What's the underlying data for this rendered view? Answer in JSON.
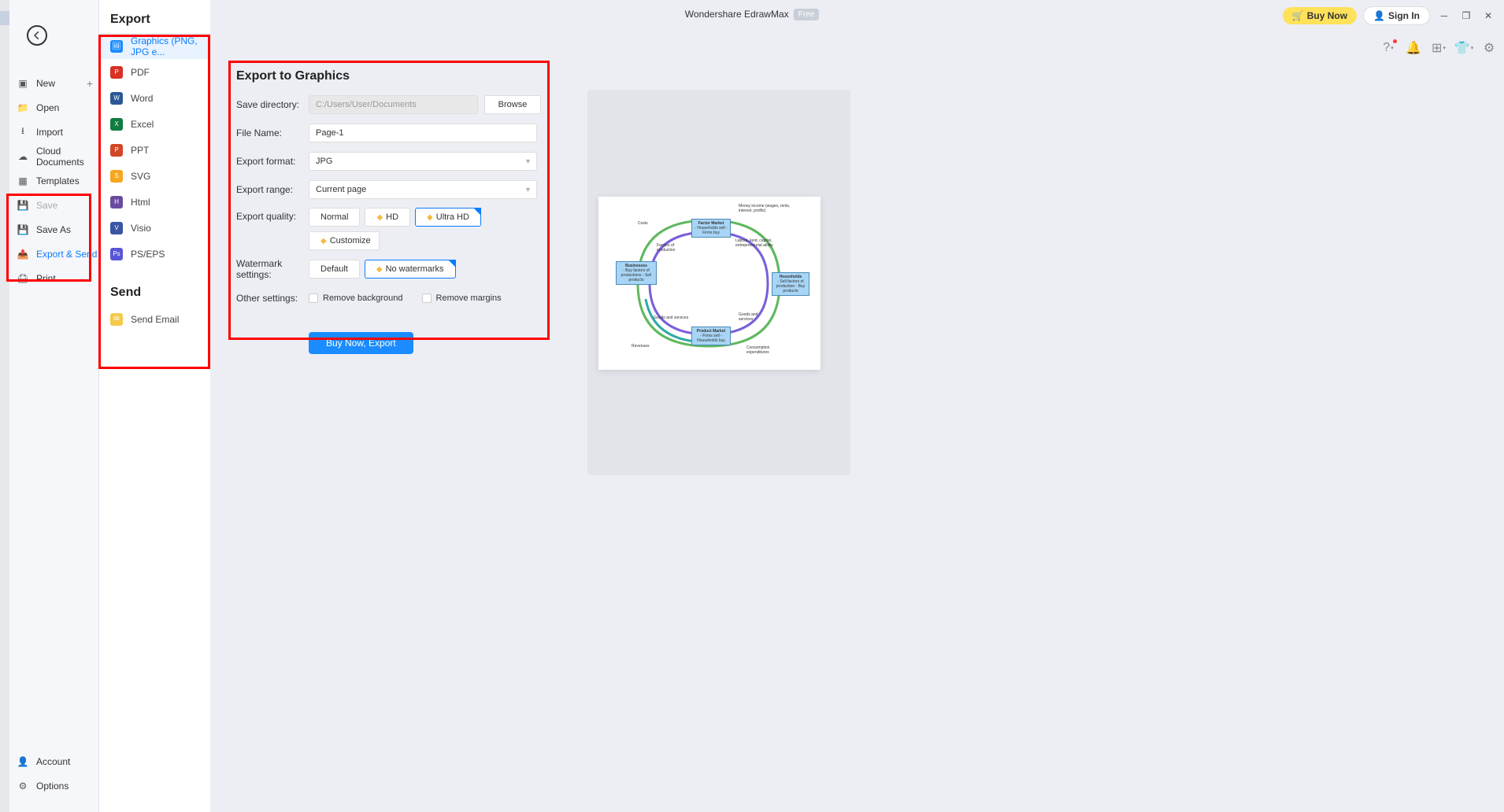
{
  "titlebar": {
    "app_title": "Wondershare EdrawMax",
    "free_badge": "Free",
    "buy_now": "Buy Now",
    "sign_in": "Sign In"
  },
  "left_sidebar": {
    "items": [
      {
        "label": "New",
        "icon": "plus-square",
        "has_plus": true
      },
      {
        "label": "Open",
        "icon": "folder"
      },
      {
        "label": "Import",
        "icon": "import"
      },
      {
        "label": "Cloud Documents",
        "icon": "cloud"
      },
      {
        "label": "Templates",
        "icon": "template"
      },
      {
        "label": "Save",
        "icon": "save",
        "disabled": true
      },
      {
        "label": "Save As",
        "icon": "save-as"
      },
      {
        "label": "Export & Send",
        "icon": "export",
        "selected": true
      },
      {
        "label": "Print",
        "icon": "print"
      }
    ],
    "bottom": [
      {
        "label": "Account",
        "icon": "account"
      },
      {
        "label": "Options",
        "icon": "gear"
      }
    ]
  },
  "export_panel": {
    "heading": "Export",
    "items": [
      {
        "label": "Graphics (PNG, JPG e...",
        "color": "#1a8cff",
        "active": true
      },
      {
        "label": "PDF",
        "color": "#d93025"
      },
      {
        "label": "Word",
        "color": "#2b5797"
      },
      {
        "label": "Excel",
        "color": "#107c41"
      },
      {
        "label": "PPT",
        "color": "#d24726"
      },
      {
        "label": "SVG",
        "color": "#f5a623"
      },
      {
        "label": "Html",
        "color": "#6a4ba0"
      },
      {
        "label": "Visio",
        "color": "#3955a3"
      },
      {
        "label": "PS/EPS",
        "color": "#5856d6"
      }
    ],
    "send_heading": "Send",
    "send_items": [
      {
        "label": "Send Email",
        "color": "#f5a623"
      }
    ]
  },
  "form": {
    "title": "Export to Graphics",
    "save_dir_label": "Save directory:",
    "save_dir_value": "C:/Users/User/Documents",
    "browse": "Browse",
    "filename_label": "File Name:",
    "filename_value": "Page-1",
    "format_label": "Export format:",
    "format_value": "JPG",
    "range_label": "Export range:",
    "range_value": "Current page",
    "quality_label": "Export quality:",
    "quality_options": {
      "normal": "Normal",
      "hd": "HD",
      "ultra_hd": "Ultra HD",
      "customize": "Customize"
    },
    "watermark_label": "Watermark settings:",
    "watermark_options": {
      "default": "Default",
      "none": "No watermarks"
    },
    "other_label": "Other settings:",
    "remove_bg": "Remove background",
    "remove_margins": "Remove margins",
    "submit": "Buy Now, Export"
  },
  "diagram": {
    "factor_market": "Factor Market",
    "factor_sub": "- Households sell\n- Firms buy",
    "product_market": "Product Market",
    "product_sub": "- Firms sell\n- Households buy",
    "businesses": "Businesses",
    "businesses_sub": "- Buy factors of productions\n- Sell products",
    "households": "Households",
    "households_sub": "- Sell factors of production\n- Buy products",
    "money_income": "Money income (wages, rents, interest, profits)",
    "costs": "Costs",
    "factors_prod": "Factors of production",
    "labour": "Labour, land, capital, entrepreneurial ability",
    "goods_services": "Goods and services",
    "goods_and": "Goods and services",
    "revenue": "Revenues",
    "consumption": "Consumption expenditures"
  }
}
